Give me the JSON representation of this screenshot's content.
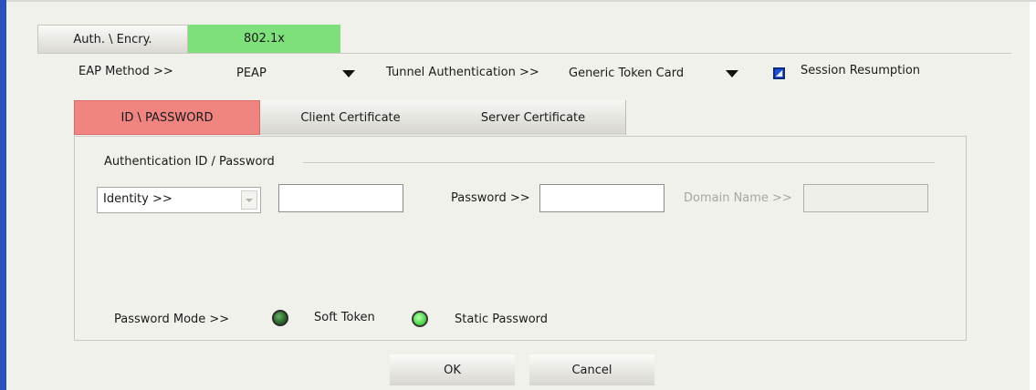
{
  "main_tabs": [
    {
      "label": "Auth. \\ Encry.",
      "active": false
    },
    {
      "label": "802.1x",
      "active": true,
      "color": "#7ee07a"
    }
  ],
  "eap": {
    "method_label": "EAP Method >>",
    "method_value": "PEAP",
    "tunnel_label": "Tunnel Authentication >>",
    "tunnel_value": "Generic Token Card",
    "session_resumption_label": "Session Resumption",
    "session_resumption_checked": true
  },
  "sub_tabs": [
    {
      "label": "ID \\ PASSWORD",
      "active": true,
      "color": "#ef8480"
    },
    {
      "label": "Client Certificate",
      "active": false
    },
    {
      "label": "Server Certificate",
      "active": false
    }
  ],
  "auth_group": {
    "title": "Authentication ID / Password",
    "identity_combo_value": "Identity >>",
    "identity_value": "",
    "password_label": "Password >>",
    "password_value": "",
    "domain_label": "Domain Name >>",
    "domain_value": ""
  },
  "password_mode": {
    "label": "Password Mode >>",
    "options": [
      {
        "label": "Soft Token",
        "selected": false
      },
      {
        "label": "Static Password",
        "selected": true
      }
    ]
  },
  "buttons": {
    "ok": "OK",
    "cancel": "Cancel"
  },
  "colors": {
    "window_border": "#2a52be",
    "active_main_tab": "#7ee07a",
    "active_sub_tab": "#ef8480"
  }
}
